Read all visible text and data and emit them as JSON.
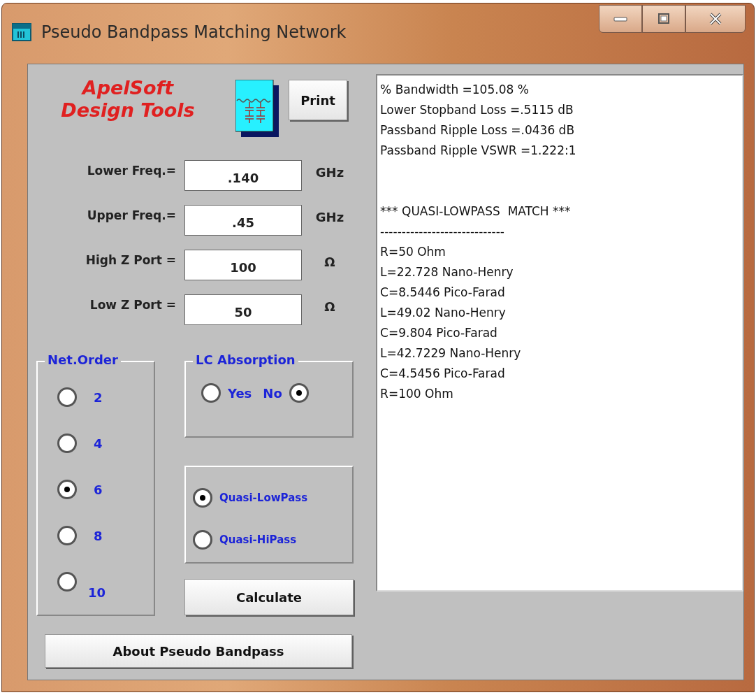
{
  "window": {
    "title": "Pseudo Bandpass Matching Network"
  },
  "logo": {
    "lines": [
      "ApelSoft",
      "Design Tools"
    ]
  },
  "print_button": {
    "label": "Print"
  },
  "fields": [
    {
      "label": "Lower Freq.=",
      "value": ".140",
      "unit": "GHz"
    },
    {
      "label": "Upper Freq.=",
      "value": ".45",
      "unit": "GHz"
    },
    {
      "label": "High Z Port =",
      "value": "100",
      "unit": "Ω"
    },
    {
      "label": "Low Z Port =",
      "value": "50",
      "unit": "Ω"
    }
  ],
  "net_order": {
    "title": "Net.Order",
    "options": [
      {
        "label": "2",
        "selected": false
      },
      {
        "label": "4",
        "selected": false
      },
      {
        "label": "6",
        "selected": true
      },
      {
        "label": "8",
        "selected": false
      },
      {
        "label": "10",
        "selected": false
      }
    ]
  },
  "lc_absorption": {
    "title": "LC Absorption",
    "options": [
      {
        "label": "Yes",
        "selected": false
      },
      {
        "label": "No",
        "selected": true
      }
    ]
  },
  "filter_type": {
    "options": [
      {
        "label": "Quasi-LowPass",
        "selected": true
      },
      {
        "label": "Quasi-HiPass",
        "selected": false
      }
    ]
  },
  "calculate_button": {
    "label": "Calculate"
  },
  "about_button": {
    "label": "About Pseudo Bandpass"
  },
  "results": {
    "summary": [
      "% Bandwidth =105.08 %",
      "Lower Stopband Loss =.5115 dB",
      "Passband Ripple Loss =.0436 dB",
      "Passband Ripple VSWR =1.222:1"
    ],
    "heading": "*** QUASI-LOWPASS  MATCH ***",
    "divider": "-----------------------------",
    "components": [
      "R=50 Ohm",
      "L=22.728 Nano-Henry",
      "C=8.5446 Pico-Farad",
      "L=49.02 Nano-Henry",
      "C=9.804 Pico-Farad",
      "L=42.7229 Nano-Henry",
      "C=4.5456 Pico-Farad",
      "R=100 Ohm"
    ]
  }
}
